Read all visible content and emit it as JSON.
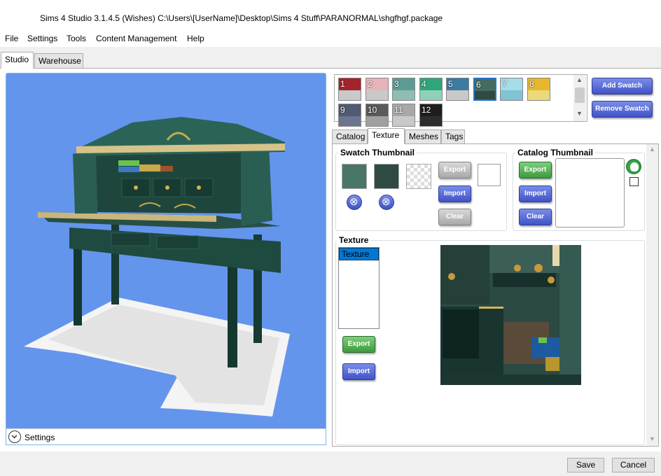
{
  "window": {
    "title": "Sims 4 Studio 3.1.4.5 (Wishes)  C:\\Users\\[UserName]\\Desktop\\Sims 4 Stuff\\PARANORMAL\\shgfhgf.package"
  },
  "menu": {
    "items": [
      "File",
      "Settings",
      "Tools",
      "Content Management",
      "Help"
    ]
  },
  "top_tabs": [
    "Studio",
    "Warehouse"
  ],
  "viewport": {
    "settings_label": "Settings",
    "background_color": "#6495ed"
  },
  "swatches": [
    {
      "num": "1",
      "top": "#a3242d",
      "bot": "#c9c9c9"
    },
    {
      "num": "2",
      "top": "#e6b4b8",
      "bot": "#c9c9c9"
    },
    {
      "num": "3",
      "top": "#5c9c95",
      "bot": "#8fbdb6"
    },
    {
      "num": "4",
      "top": "#2fa67a",
      "bot": "#8fd1b6"
    },
    {
      "num": "5",
      "top": "#3b7ca0",
      "bot": "#c9c9c9"
    },
    {
      "num": "6",
      "top": "#466b60",
      "bot": "#2f4a43",
      "selected": true
    },
    {
      "num": "7",
      "top": "#a6dbe8",
      "bot": "#7fc3d4"
    },
    {
      "num": "8",
      "top": "#e6b82e",
      "bot": "#ecd978"
    },
    {
      "num": "9",
      "top": "#505a70",
      "bot": "#6b7590"
    },
    {
      "num": "10",
      "top": "#5a5a5a",
      "bot": "#a0a0a0"
    },
    {
      "num": "11",
      "top": "#a8a8a8",
      "bot": "#c9c9c9"
    },
    {
      "num": "12",
      "top": "#1e1e1e",
      "bot": "#2d2d2d"
    }
  ],
  "swatch_buttons": {
    "add": "Add Swatch",
    "remove": "Remove Swatch"
  },
  "sub_tabs": [
    "Catalog",
    "Texture",
    "Meshes",
    "Tags"
  ],
  "swatch_thumbnail": {
    "title": "Swatch Thumbnail",
    "colors": [
      "#4a7668",
      "#2f4a43"
    ],
    "export": "Export",
    "import": "Import",
    "clear": "Clear"
  },
  "catalog_thumbnail": {
    "title": "Catalog Thumbnail",
    "export": "Export",
    "import": "Import",
    "clear": "Clear"
  },
  "texture_section": {
    "title": "Texture",
    "list_items": [
      "Texture"
    ],
    "export": "Export",
    "import": "Import"
  },
  "footer": {
    "save": "Save",
    "cancel": "Cancel"
  }
}
